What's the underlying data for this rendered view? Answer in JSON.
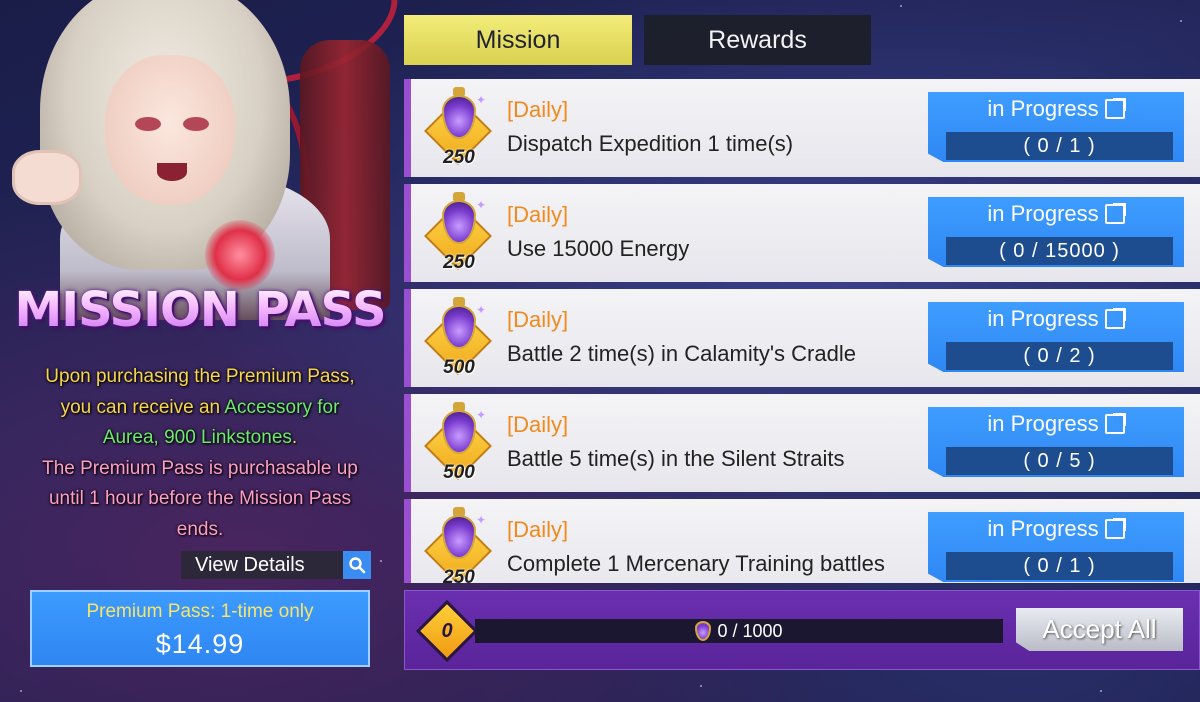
{
  "left_panel": {
    "title": "MISSION PASS",
    "desc_line1": "Upon purchasing the Premium Pass,",
    "desc_line2_prefix": "you can receive an ",
    "desc_line2_highlight": "Accessory for",
    "desc_line3_highlight": "Aurea, 900 Linkstones",
    "desc_line3_suffix": ".",
    "desc_line4": "The Premium Pass is purchasable up",
    "desc_line5": "until 1 hour before the Mission Pass",
    "desc_line6": "ends.",
    "view_details_label": "View Details",
    "premium": {
      "label": "Premium Pass: 1-time only",
      "price": "$14.99"
    }
  },
  "tabs": [
    {
      "label": "Mission",
      "active": true
    },
    {
      "label": "Rewards",
      "active": false
    }
  ],
  "missions": [
    {
      "category": "[Daily]",
      "text": "Dispatch Expedition 1 time(s)",
      "reward": "250",
      "status": "in Progress",
      "progress": "( 0 / 1 )"
    },
    {
      "category": "[Daily]",
      "text": "Use 15000 Energy",
      "reward": "250",
      "status": "in Progress",
      "progress": "( 0 / 15000 )"
    },
    {
      "category": "[Daily]",
      "text": "Battle 2 time(s) in Calamity's Cradle",
      "reward": "500",
      "status": "in Progress",
      "progress": "( 0 / 2 )"
    },
    {
      "category": "[Daily]",
      "text": "Battle 5 time(s) in the Silent Straits",
      "reward": "500",
      "status": "in Progress",
      "progress": "( 0 / 5 )"
    },
    {
      "category": "[Daily]",
      "text": "Complete 1 Mercenary Training battles",
      "reward": "250",
      "status": "in Progress",
      "progress": "( 0 / 1 )"
    }
  ],
  "bottom_bar": {
    "level": "0",
    "points": "0 / 1000",
    "points_fraction": 0,
    "accept_all_label": "Accept All"
  },
  "icons": {
    "reward": "linkstone-flask-icon",
    "status": "external-link-icon",
    "search": "magnifier-icon"
  },
  "colors": {
    "accent_yellow": "#f3ec7a",
    "button_blue": "#2f87f3",
    "daily_orange": "#f08a1c",
    "bar_purple": "#6a2fb0"
  }
}
